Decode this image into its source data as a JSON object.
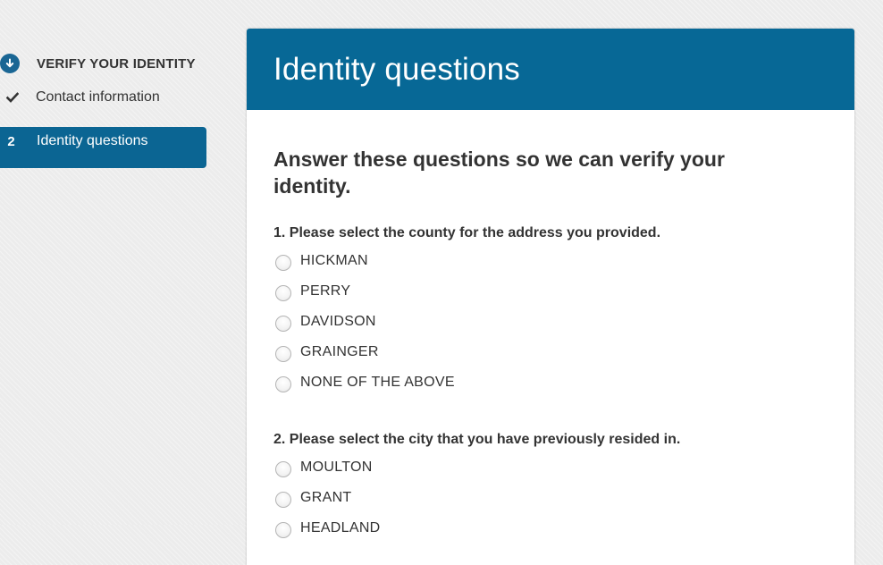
{
  "sidebar": {
    "section_title": "VERIFY YOUR IDENTITY",
    "steps": [
      {
        "label": "Contact information",
        "status": "done"
      },
      {
        "number": "2",
        "label": "Identity questions",
        "status": "active"
      }
    ]
  },
  "card": {
    "title": "Identity questions",
    "instruction": "Answer these questions so we can verify your identity.",
    "questions": [
      {
        "text": "1. Please select the county for the address you provided.",
        "options": [
          "HICKMAN",
          "PERRY",
          "DAVIDSON",
          "GRAINGER",
          "NONE OF THE ABOVE"
        ]
      },
      {
        "text": "2. Please select the city that you have previously resided in.",
        "options": [
          "MOULTON",
          "GRANT",
          "HEADLAND"
        ]
      }
    ]
  },
  "colors": {
    "accent": "#076896",
    "active_step": "#0b6593",
    "background": "#ececec"
  }
}
